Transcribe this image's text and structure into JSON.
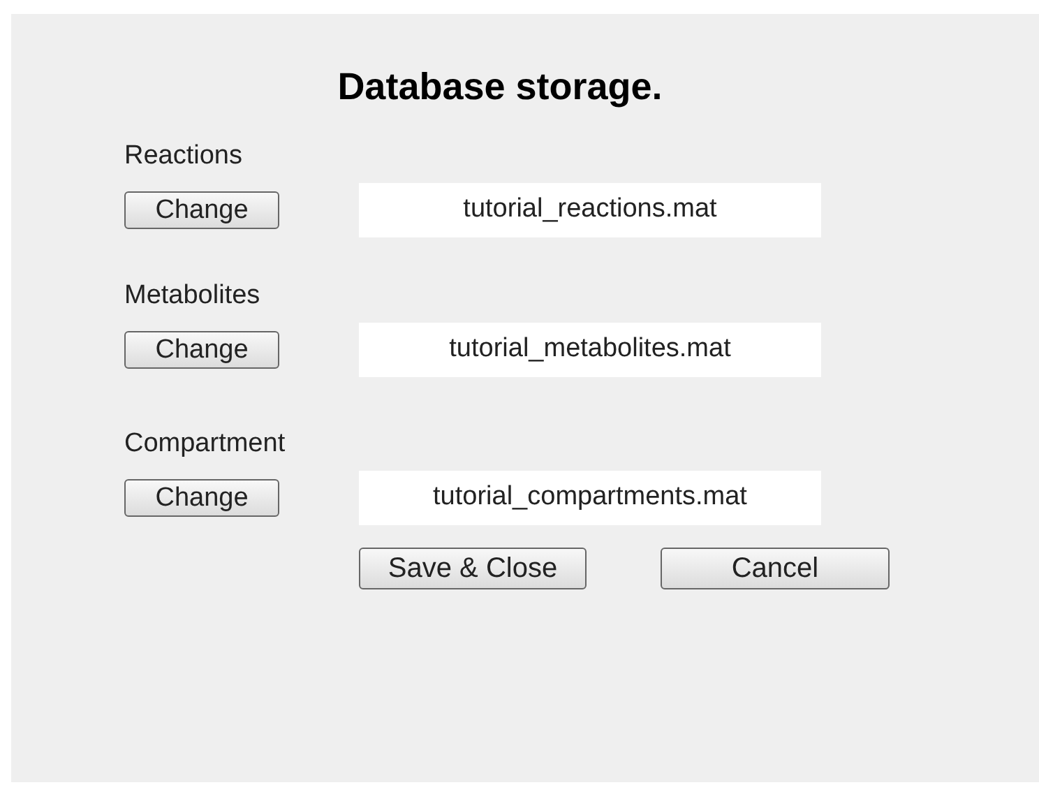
{
  "title": "Database storage.",
  "sections": [
    {
      "label": "Reactions",
      "button": "Change",
      "value": "tutorial_reactions.mat"
    },
    {
      "label": "Metabolites",
      "button": "Change",
      "value": "tutorial_metabolites.mat"
    },
    {
      "label": "Compartment",
      "button": "Change",
      "value": "tutorial_compartments.mat"
    }
  ],
  "buttons": [
    "Save & Close",
    "Cancel"
  ]
}
